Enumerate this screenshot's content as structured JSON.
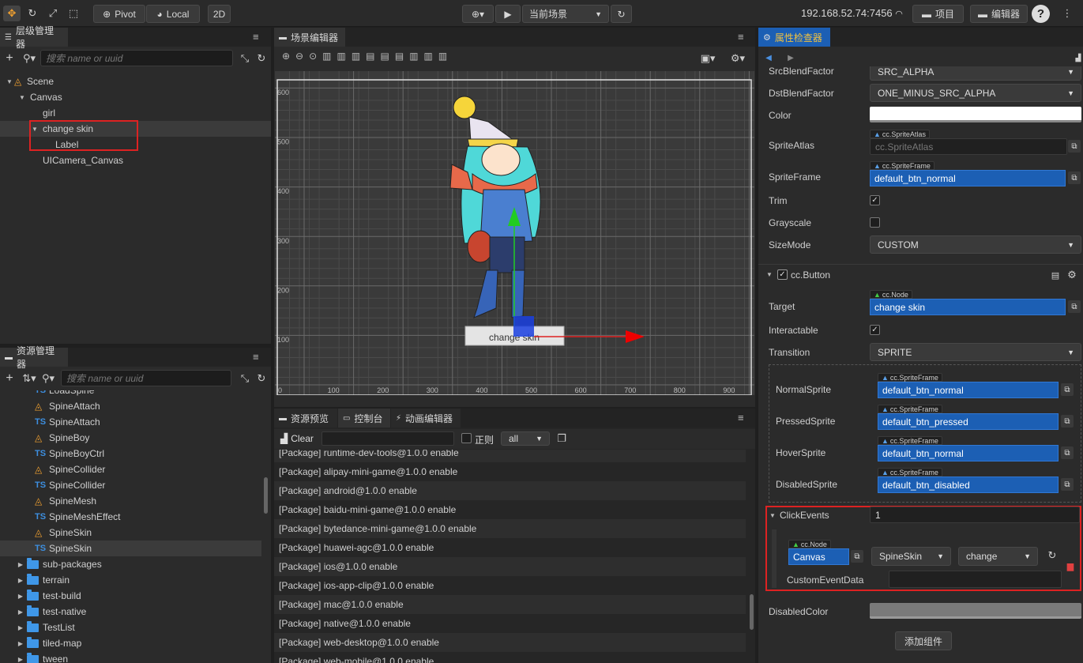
{
  "toolbar": {
    "pivot": "Pivot",
    "local": "Local",
    "mode2d": "2D",
    "scene_select": "当前场景",
    "ip": "192.168.52.74:7456",
    "project": "项目",
    "editor": "编辑器",
    "help": "?"
  },
  "hierarchy": {
    "title": "层级管理器",
    "search_placeholder": "搜索 name or uuid",
    "nodes": [
      "Scene",
      "Canvas",
      "girl",
      "change skin",
      "Label",
      "UICamera_Canvas"
    ]
  },
  "assets": {
    "title": "资源管理器",
    "search_placeholder": "搜索 name or uuid",
    "items": [
      {
        "label": "LoadSpine",
        "kind": "ts"
      },
      {
        "label": "SpineAttach",
        "kind": "fire"
      },
      {
        "label": "SpineAttach",
        "kind": "ts"
      },
      {
        "label": "SpineBoy",
        "kind": "fire"
      },
      {
        "label": "SpineBoyCtrl",
        "kind": "ts"
      },
      {
        "label": "SpineCollider",
        "kind": "fire"
      },
      {
        "label": "SpineCollider",
        "kind": "ts"
      },
      {
        "label": "SpineMesh",
        "kind": "fire"
      },
      {
        "label": "SpineMeshEffect",
        "kind": "ts"
      },
      {
        "label": "SpineSkin",
        "kind": "fire"
      },
      {
        "label": "SpineSkin",
        "kind": "ts"
      }
    ],
    "folders": [
      "sub-packages",
      "terrain",
      "test-build",
      "test-native",
      "TestList",
      "tiled-map",
      "tween"
    ]
  },
  "scene": {
    "title": "场景编辑器",
    "button_label": "change skin",
    "y_ticks": [
      "600",
      "500",
      "400",
      "300",
      "200",
      "100"
    ],
    "x_ticks": [
      "0",
      "100",
      "200",
      "300",
      "400",
      "500",
      "600",
      "700",
      "800",
      "900"
    ]
  },
  "console": {
    "tabs": [
      "资源预览",
      "控制台",
      "动画编辑器"
    ],
    "clear": "Clear",
    "regex": "正则",
    "filter": "all",
    "logs": [
      "[Package] runtime-dev-tools@1.0.0 enable",
      "[Package] alipay-mini-game@1.0.0 enable",
      "[Package] android@1.0.0 enable",
      "[Package] baidu-mini-game@1.0.0 enable",
      "[Package] bytedance-mini-game@1.0.0 enable",
      "[Package] huawei-agc@1.0.0 enable",
      "[Package] ios@1.0.0 enable",
      "[Package] ios-app-clip@1.0.0 enable",
      "[Package] mac@1.0.0 enable",
      "[Package] native@1.0.0 enable",
      "[Package] web-desktop@1.0.0 enable",
      "[Package] web-mobile@1.0.0 enable"
    ]
  },
  "inspector": {
    "title": "属性检查器",
    "src_blend": {
      "label": "SrcBlendFactor",
      "value": "SRC_ALPHA"
    },
    "dst_blend": {
      "label": "DstBlendFactor",
      "value": "ONE_MINUS_SRC_ALPHA"
    },
    "color": {
      "label": "Color",
      "value": "#ffffff"
    },
    "sprite_atlas": {
      "label": "SpriteAtlas",
      "tag": "cc.SpriteAtlas",
      "value": "cc.SpriteAtlas"
    },
    "sprite_frame": {
      "label": "SpriteFrame",
      "tag": "cc.SpriteFrame",
      "value": "default_btn_normal"
    },
    "trim": {
      "label": "Trim",
      "checked": true
    },
    "grayscale": {
      "label": "Grayscale",
      "checked": false
    },
    "size_mode": {
      "label": "SizeMode",
      "value": "CUSTOM"
    },
    "button": {
      "label": "cc.Button",
      "target": {
        "label": "Target",
        "tag": "cc.Node",
        "value": "change skin"
      },
      "interactable": {
        "label": "Interactable",
        "checked": true
      },
      "transition": {
        "label": "Transition",
        "value": "SPRITE"
      },
      "normal": {
        "label": "NormalSprite",
        "tag": "cc.SpriteFrame",
        "value": "default_btn_normal"
      },
      "pressed": {
        "label": "PressedSprite",
        "tag": "cc.SpriteFrame",
        "value": "default_btn_pressed"
      },
      "hover": {
        "label": "HoverSprite",
        "tag": "cc.SpriteFrame",
        "value": "default_btn_normal"
      },
      "disabled": {
        "label": "DisabledSprite",
        "tag": "cc.SpriteFrame",
        "value": "default_btn_disabled"
      },
      "click_events": {
        "label": "ClickEvents",
        "count": "1",
        "tag": "cc.Node",
        "node": "Canvas",
        "component": "SpineSkin",
        "handler": "change",
        "custom_label": "CustomEventData"
      },
      "disabled_color": {
        "label": "DisabledColor",
        "value": "#7a7a7a"
      }
    },
    "add_component": "添加组件"
  }
}
